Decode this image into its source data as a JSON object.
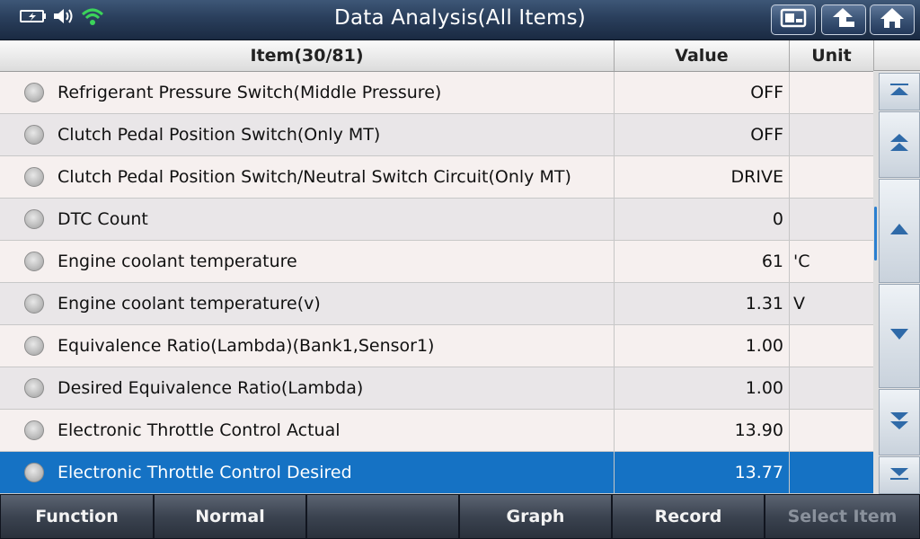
{
  "header": {
    "title": "Data Analysis(All Items)"
  },
  "table": {
    "columns": {
      "item": "Item(30/81)",
      "value": "Value",
      "unit": "Unit"
    },
    "rows": [
      {
        "name": "Refrigerant Pressure Switch(Middle Pressure)",
        "value": "OFF",
        "unit": ""
      },
      {
        "name": "Clutch Pedal Position Switch(Only MT)",
        "value": "OFF",
        "unit": ""
      },
      {
        "name": "Clutch Pedal Position Switch/Neutral Switch Circuit(Only MT)",
        "value": "DRIVE",
        "unit": ""
      },
      {
        "name": "DTC Count",
        "value": "0",
        "unit": ""
      },
      {
        "name": "Engine coolant temperature",
        "value": "61",
        "unit": "'C"
      },
      {
        "name": "Engine coolant temperature(v)",
        "value": "1.31",
        "unit": "V"
      },
      {
        "name": "Equivalence Ratio(Lambda)(Bank1,Sensor1)",
        "value": "1.00",
        "unit": ""
      },
      {
        "name": "Desired Equivalence Ratio(Lambda)",
        "value": "1.00",
        "unit": ""
      },
      {
        "name": "Electronic Throttle Control Actual",
        "value": "13.90",
        "unit": ""
      },
      {
        "name": "Electronic Throttle Control Desired",
        "value": "13.77",
        "unit": ""
      }
    ]
  },
  "footer": {
    "function": "Function",
    "normal": "Normal",
    "blank": "",
    "graph": "Graph",
    "record": "Record",
    "select_item": "Select Item"
  },
  "colors": {
    "selected_row": "#1572c4",
    "scroll_thumb": "#2a7fd0",
    "wifi": "#3bd35a"
  },
  "icons": [
    "battery-icon",
    "speaker-icon",
    "wifi-icon",
    "screenshot-icon",
    "back-icon",
    "home-icon",
    "scroll-top-icon",
    "page-up-icon",
    "line-up-icon",
    "line-down-icon",
    "page-down-icon",
    "scroll-bottom-icon"
  ]
}
